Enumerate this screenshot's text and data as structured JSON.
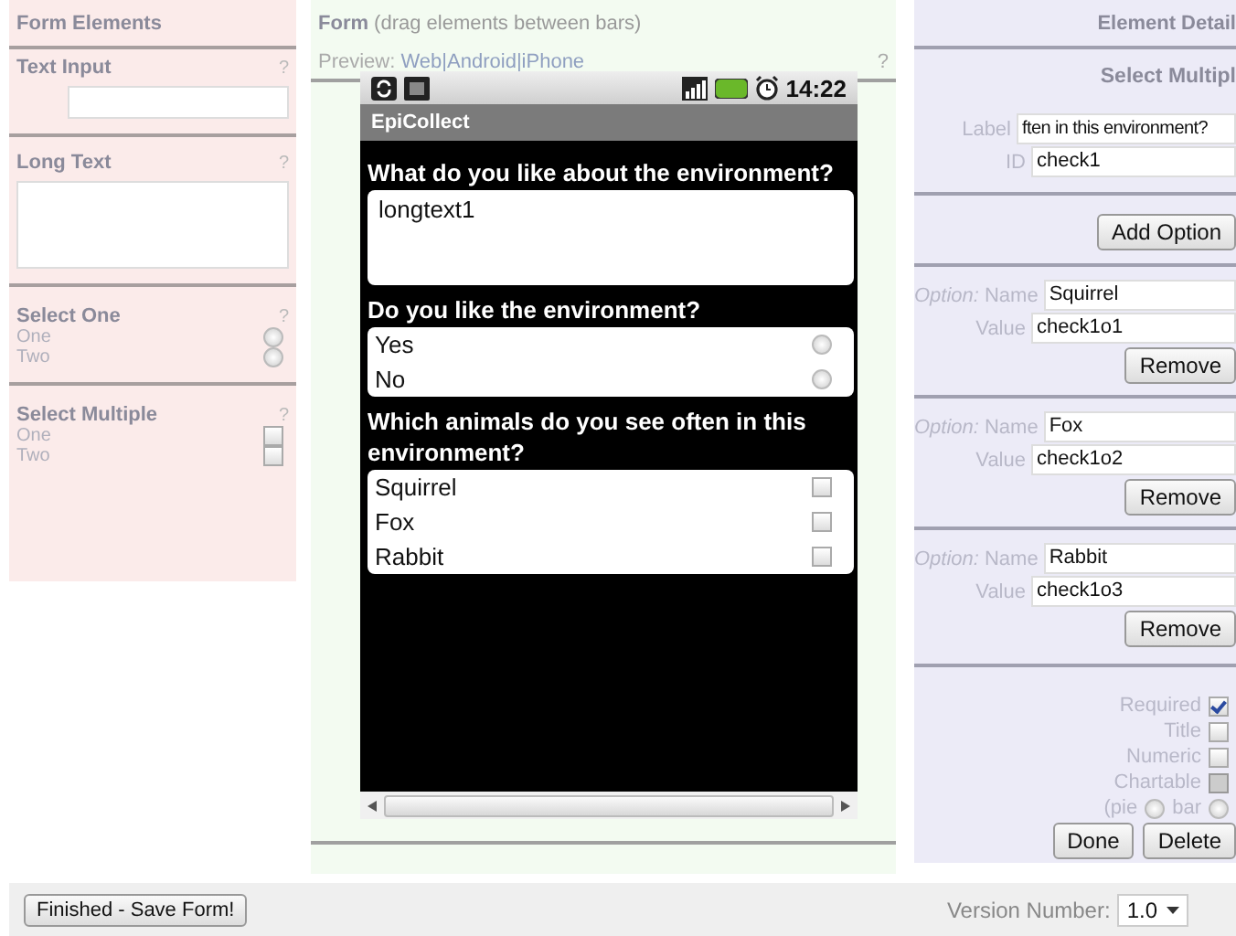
{
  "left_panel": {
    "title": "Form Elements",
    "sections": [
      {
        "kind": "text_input",
        "title": "Text Input",
        "help": "?"
      },
      {
        "kind": "long_text",
        "title": "Long Text",
        "help": "?"
      },
      {
        "kind": "select_one",
        "title": "Select One",
        "help": "?",
        "options": [
          {
            "label": "One",
            "checked": false
          },
          {
            "label": "Two",
            "checked": false
          }
        ]
      },
      {
        "kind": "select_multiple",
        "title": "Select Multiple",
        "help": "?",
        "options": [
          {
            "label": "One",
            "checked": false
          },
          {
            "label": "Two",
            "checked": false
          }
        ]
      }
    ]
  },
  "form_panel": {
    "title": "**Form** (drag elements between bars)",
    "preview_label": "Preview:",
    "preview_links": "Web|Android|iPhone",
    "help": "?",
    "phone": {
      "time": "14:22",
      "app_title": "EpiCollect",
      "questions": [
        {
          "kind": "long_text",
          "label": "What do you like about the environment?",
          "value": "longtext1"
        },
        {
          "kind": "select_one",
          "label": "Do you like the environment?",
          "options": [
            {
              "label": "Yes",
              "checked": false
            },
            {
              "label": "No",
              "checked": false
            }
          ]
        },
        {
          "kind": "select_multiple",
          "label": "Which animals do you see often in this environment?",
          "options": [
            {
              "label": "Squirrel",
              "checked": false
            },
            {
              "label": "Fox",
              "checked": false
            },
            {
              "label": "Rabbit",
              "checked": false
            }
          ]
        }
      ]
    }
  },
  "details_panel": {
    "title": "Element Detail",
    "type": "Select Multipl",
    "label_field": {
      "label": "Label",
      "value": "ften in this environment?"
    },
    "id_field": {
      "label": "ID",
      "value": "check1"
    },
    "add_button": "Add Option",
    "options": [
      {
        "prefix": "Option:",
        "name_label": "Name",
        "name": "Squirrel",
        "value_label": "Value",
        "value": "check1o1",
        "remove_button": "Remove"
      },
      {
        "prefix": "Option:",
        "name_label": "Name",
        "name": "Fox",
        "value_label": "Value",
        "value": "check1o2",
        "remove_button": "Remove"
      },
      {
        "prefix": "Option:",
        "name_label": "Name",
        "name": "Rabbit",
        "value_label": "Value",
        "value": "check1o3",
        "remove_button": "Remove"
      }
    ],
    "flags": [
      {
        "label": "Required",
        "checked": true,
        "disabled": false
      },
      {
        "label": "Title",
        "checked": false,
        "disabled": false
      },
      {
        "label": "Numeric",
        "checked": false,
        "disabled": false
      },
      {
        "label": "Chartable",
        "checked": false,
        "disabled": true
      }
    ],
    "chart_types": [
      {
        "label": "(pie",
        "selected": false
      },
      {
        "label": "bar",
        "selected": false
      }
    ],
    "buttons": [
      "Done",
      "Delete"
    ]
  },
  "footer": {
    "save_button": "Finished - Save Form!",
    "version_label": "Version Number:",
    "version": "1.0"
  }
}
